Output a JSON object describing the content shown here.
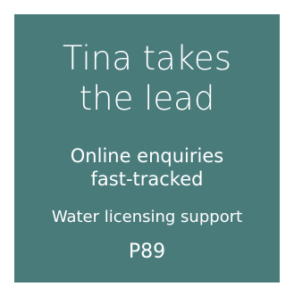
{
  "card": {
    "headline_line1": "Tina takes",
    "headline_line2": "the lead",
    "sub_line1": "Online enquiries",
    "sub_line2": "fast-tracked",
    "meta": "Water licensing support",
    "page": "P89",
    "colors": {
      "background": "#4a7b7b",
      "text": "#ffffff"
    }
  }
}
